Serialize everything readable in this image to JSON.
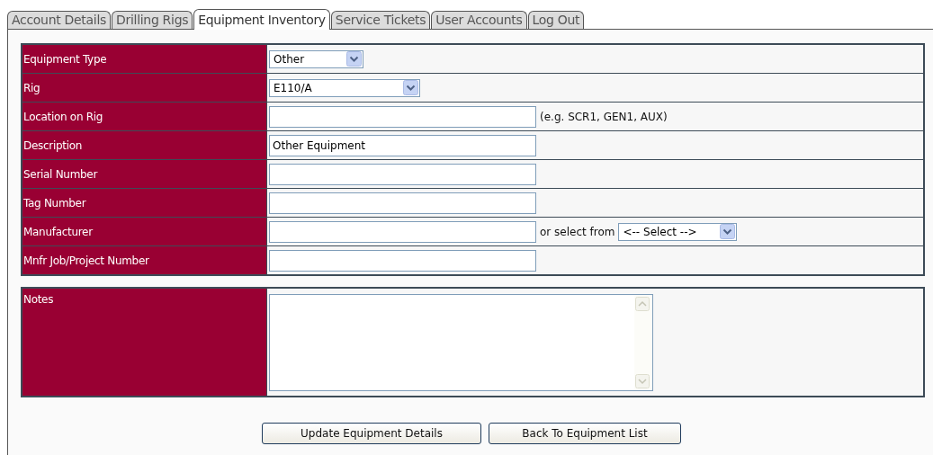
{
  "tabs": [
    {
      "label": "Account Details",
      "selected": false
    },
    {
      "label": "Drilling Rigs",
      "selected": false
    },
    {
      "label": "Equipment Inventory",
      "selected": true
    },
    {
      "label": "Service Tickets",
      "selected": false
    },
    {
      "label": "User Accounts",
      "selected": false
    },
    {
      "label": "Log Out",
      "selected": false
    }
  ],
  "form": {
    "rows": [
      {
        "label": "Equipment Type",
        "kind": "select",
        "value": "Other"
      },
      {
        "label": "Rig",
        "kind": "select",
        "value": "E110/A"
      },
      {
        "label": "Location on Rig",
        "kind": "text",
        "hint": "(e.g. SCR1, GEN1, AUX)"
      },
      {
        "label": "Description",
        "kind": "text",
        "value": "Other Equipment"
      },
      {
        "label": "Serial Number",
        "kind": "text"
      },
      {
        "label": "Tag Number",
        "kind": "text"
      },
      {
        "label": "Manufacturer",
        "kind": "text",
        "or_label": "or select from",
        "select_value": "<-- Select -->"
      },
      {
        "label": "Mnfr Job/Project Number",
        "kind": "text"
      }
    ]
  },
  "notes": {
    "label": "Notes"
  },
  "buttons": [
    "Update Equipment Details",
    "Back To Equipment List"
  ]
}
